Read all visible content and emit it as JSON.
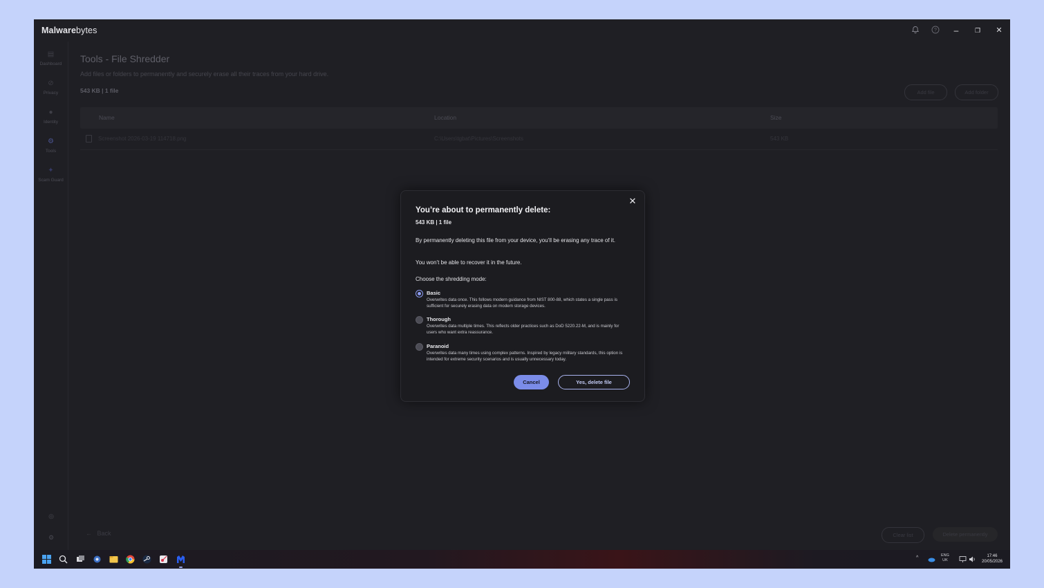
{
  "app": {
    "brand_bold": "Malware",
    "brand_rest": "bytes",
    "brand_display_m": "M"
  },
  "titlebar": {
    "bell": "🔔",
    "help": "?",
    "minimize": "–",
    "restore": "❐",
    "close": "✕"
  },
  "sidebar": {
    "items": [
      {
        "label": "Dashboard",
        "icon": "▤"
      },
      {
        "label": "Privacy",
        "icon": "⊘"
      },
      {
        "label": "Identity",
        "icon": "●"
      },
      {
        "label": "Tools",
        "icon": "⚙"
      },
      {
        "label": "Scam Guard",
        "icon": "✦"
      }
    ],
    "account_icon": "◎",
    "settings_icon": "⚙"
  },
  "page": {
    "title": "Tools - File Shredder",
    "subtitle": "Add files or folders to permanently and securely erase all their traces from your hard drive.",
    "summary": "543 KB | 1 file",
    "add_file": "Add file",
    "add_folder": "Add folder"
  },
  "table": {
    "headers": [
      "Name",
      "Location",
      "Size"
    ],
    "rows": [
      {
        "name": "Screenshot 2026-03-19 114718.png",
        "location": "C:\\Users\\tgbat\\Pictures\\Screenshots",
        "size": "543 KB"
      }
    ]
  },
  "footer": {
    "back": "Back",
    "clear_list": "Clear list",
    "delete_permanently": "Delete permanently"
  },
  "modal": {
    "title": "You’re about to permanently delete:",
    "size": "543 KB | 1 file",
    "para1": "By permanently deleting this file from your device, you’ll be erasing any trace of it.",
    "para2": "You won’t be able to recover it in the future.",
    "choose": "Choose the shredding mode:",
    "options": [
      {
        "title": "Basic",
        "desc": "Overwrites data once. This follows modern guidance from NIST 800-88, which states a single pass is sufficient for securely erasing data on modern storage devices.",
        "selected": true
      },
      {
        "title": "Thorough",
        "desc": "Overwrites data multiple times. This reflects older practices such as DoD 5220.22-M, and is mainly for users who want extra reassurance.",
        "selected": false
      },
      {
        "title": "Paranoid",
        "desc": "Overwrites data many times using complex patterns. Inspired by legacy military standards, this option is intended for extreme security scenarios and is usually unnecessary today.",
        "selected": false
      }
    ],
    "cancel": "Cancel",
    "confirm": "Yes, delete file",
    "close": "✕"
  },
  "taskbar": {
    "tray_up": "^",
    "lang_top": "ENG",
    "lang_bottom": "UK",
    "time": "17:46",
    "date": "20/05/2026"
  },
  "colors": {
    "accent": "#7b8ce8",
    "background": "#1f1f24",
    "desktop": "#c5d3fb"
  }
}
